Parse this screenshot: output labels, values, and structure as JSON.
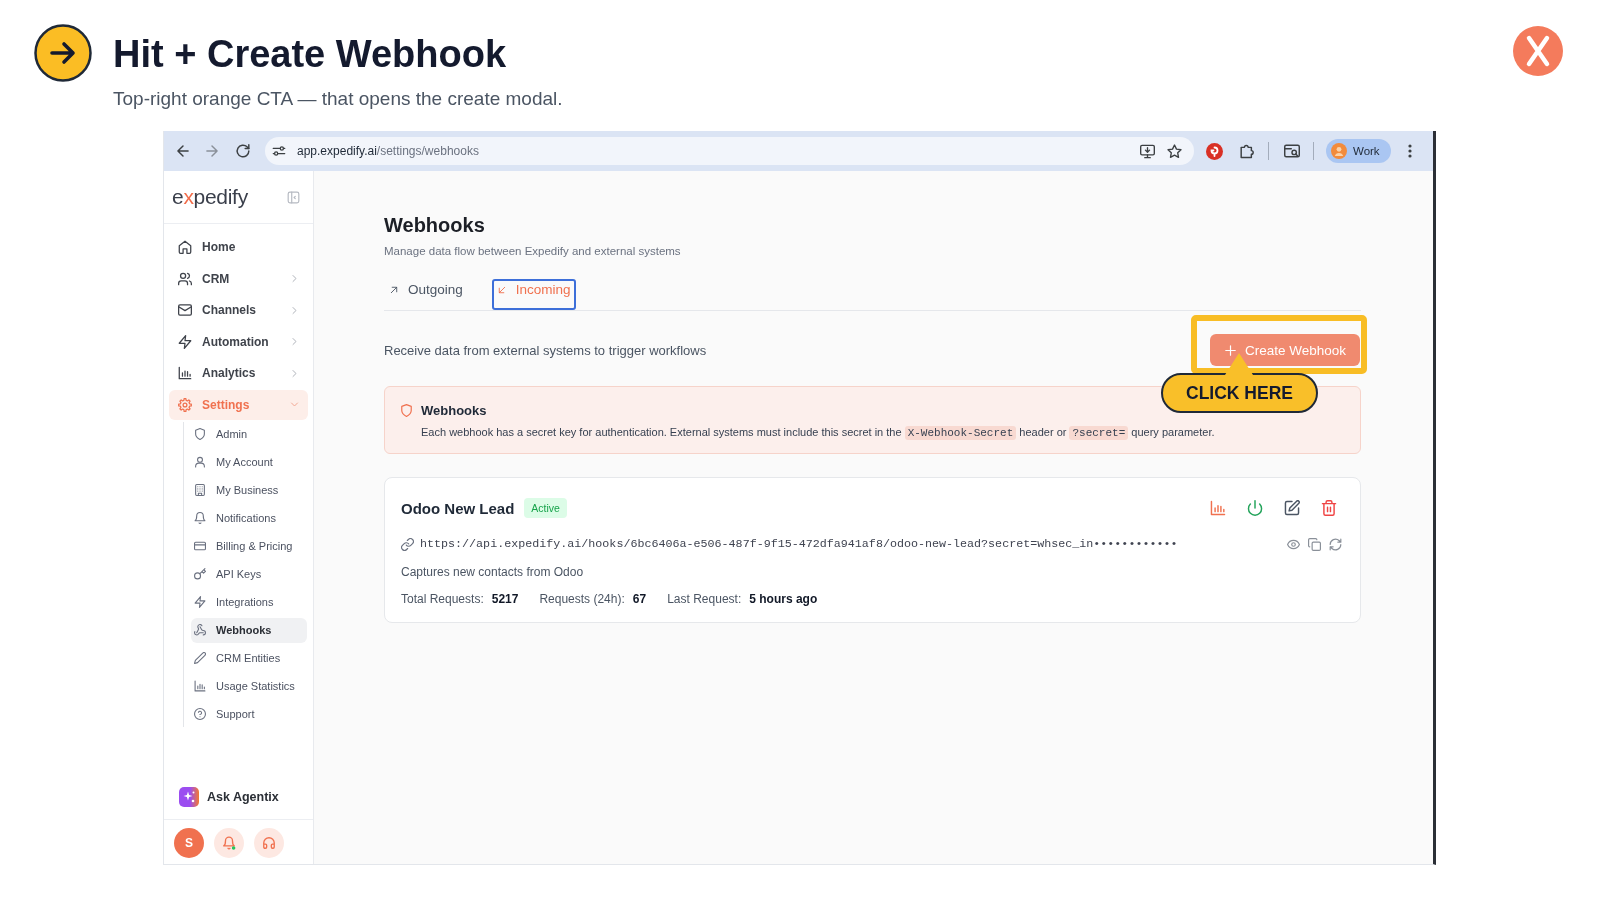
{
  "slide": {
    "title": "Hit + Create Webhook",
    "subtitle": "Top-right orange CTA — that opens the create modal."
  },
  "browser": {
    "url": {
      "host": "app.expedify.ai",
      "path": "/settings/webhooks"
    },
    "profile": "Work"
  },
  "sidebar": {
    "logo": "expedify",
    "items": [
      {
        "label": "Home",
        "kind": "link",
        "selected": false
      },
      {
        "label": "CRM",
        "kind": "group",
        "selected": false,
        "expanded": false
      },
      {
        "label": "Channels",
        "kind": "group",
        "selected": false,
        "expanded": false
      },
      {
        "label": "Automation",
        "kind": "group",
        "selected": false,
        "expanded": false
      },
      {
        "label": "Analytics",
        "kind": "group",
        "selected": false,
        "expanded": false
      },
      {
        "label": "Settings",
        "kind": "group",
        "selected": true,
        "expanded": true,
        "children": [
          {
            "label": "Admin",
            "selected": false
          },
          {
            "label": "My Account",
            "selected": false
          },
          {
            "label": "My Business",
            "selected": false
          },
          {
            "label": "Notifications",
            "selected": false
          },
          {
            "label": "Billing & Pricing",
            "selected": false
          },
          {
            "label": "API Keys",
            "selected": false
          },
          {
            "label": "Integrations",
            "selected": false
          },
          {
            "label": "Webhooks",
            "selected": true
          },
          {
            "label": "CRM Entities",
            "selected": false
          },
          {
            "label": "Usage Statistics",
            "selected": false
          },
          {
            "label": "Support",
            "selected": false
          }
        ]
      }
    ],
    "assistant": "Ask Agentix",
    "avatar_initial": "S"
  },
  "page": {
    "title": "Webhooks",
    "subtitle": "Manage data flow between Expedify and external systems",
    "tabs": [
      {
        "label": "Outgoing",
        "selected": false,
        "focused": false
      },
      {
        "label": "Incoming",
        "selected": true,
        "focused": true
      }
    ],
    "description": "Receive data from external systems to trigger workflows",
    "create_button": {
      "label": "Create Webhook",
      "highlighted": true
    },
    "callout": "CLICK HERE",
    "notice": {
      "title": "Webhooks",
      "parts": [
        {
          "kind": "text",
          "text": "Each webhook has a secret key for authentication. External systems must include this secret in the "
        },
        {
          "kind": "code",
          "text": "X-Webhook-Secret"
        },
        {
          "kind": "text",
          "text": " header or "
        },
        {
          "kind": "code",
          "text": "?secret="
        },
        {
          "kind": "text",
          "text": " query parameter."
        }
      ]
    },
    "webhooks": [
      {
        "name": "Odoo New Lead",
        "status": {
          "label": "Active",
          "kind": "active"
        },
        "url": "https://api.expedify.ai/hooks/6bc6406a-e506-487f-9f15-472dfa941af8/odoo-new-lead?secret=whsec_in••••••••••••",
        "description": "Captures new contacts from Odoo",
        "stats": [
          {
            "label": "Total Requests:",
            "value": "5217"
          },
          {
            "label": "Requests (24h):",
            "value": "67"
          },
          {
            "label": "Last Request:",
            "value": "5 hours ago"
          }
        ]
      }
    ]
  }
}
